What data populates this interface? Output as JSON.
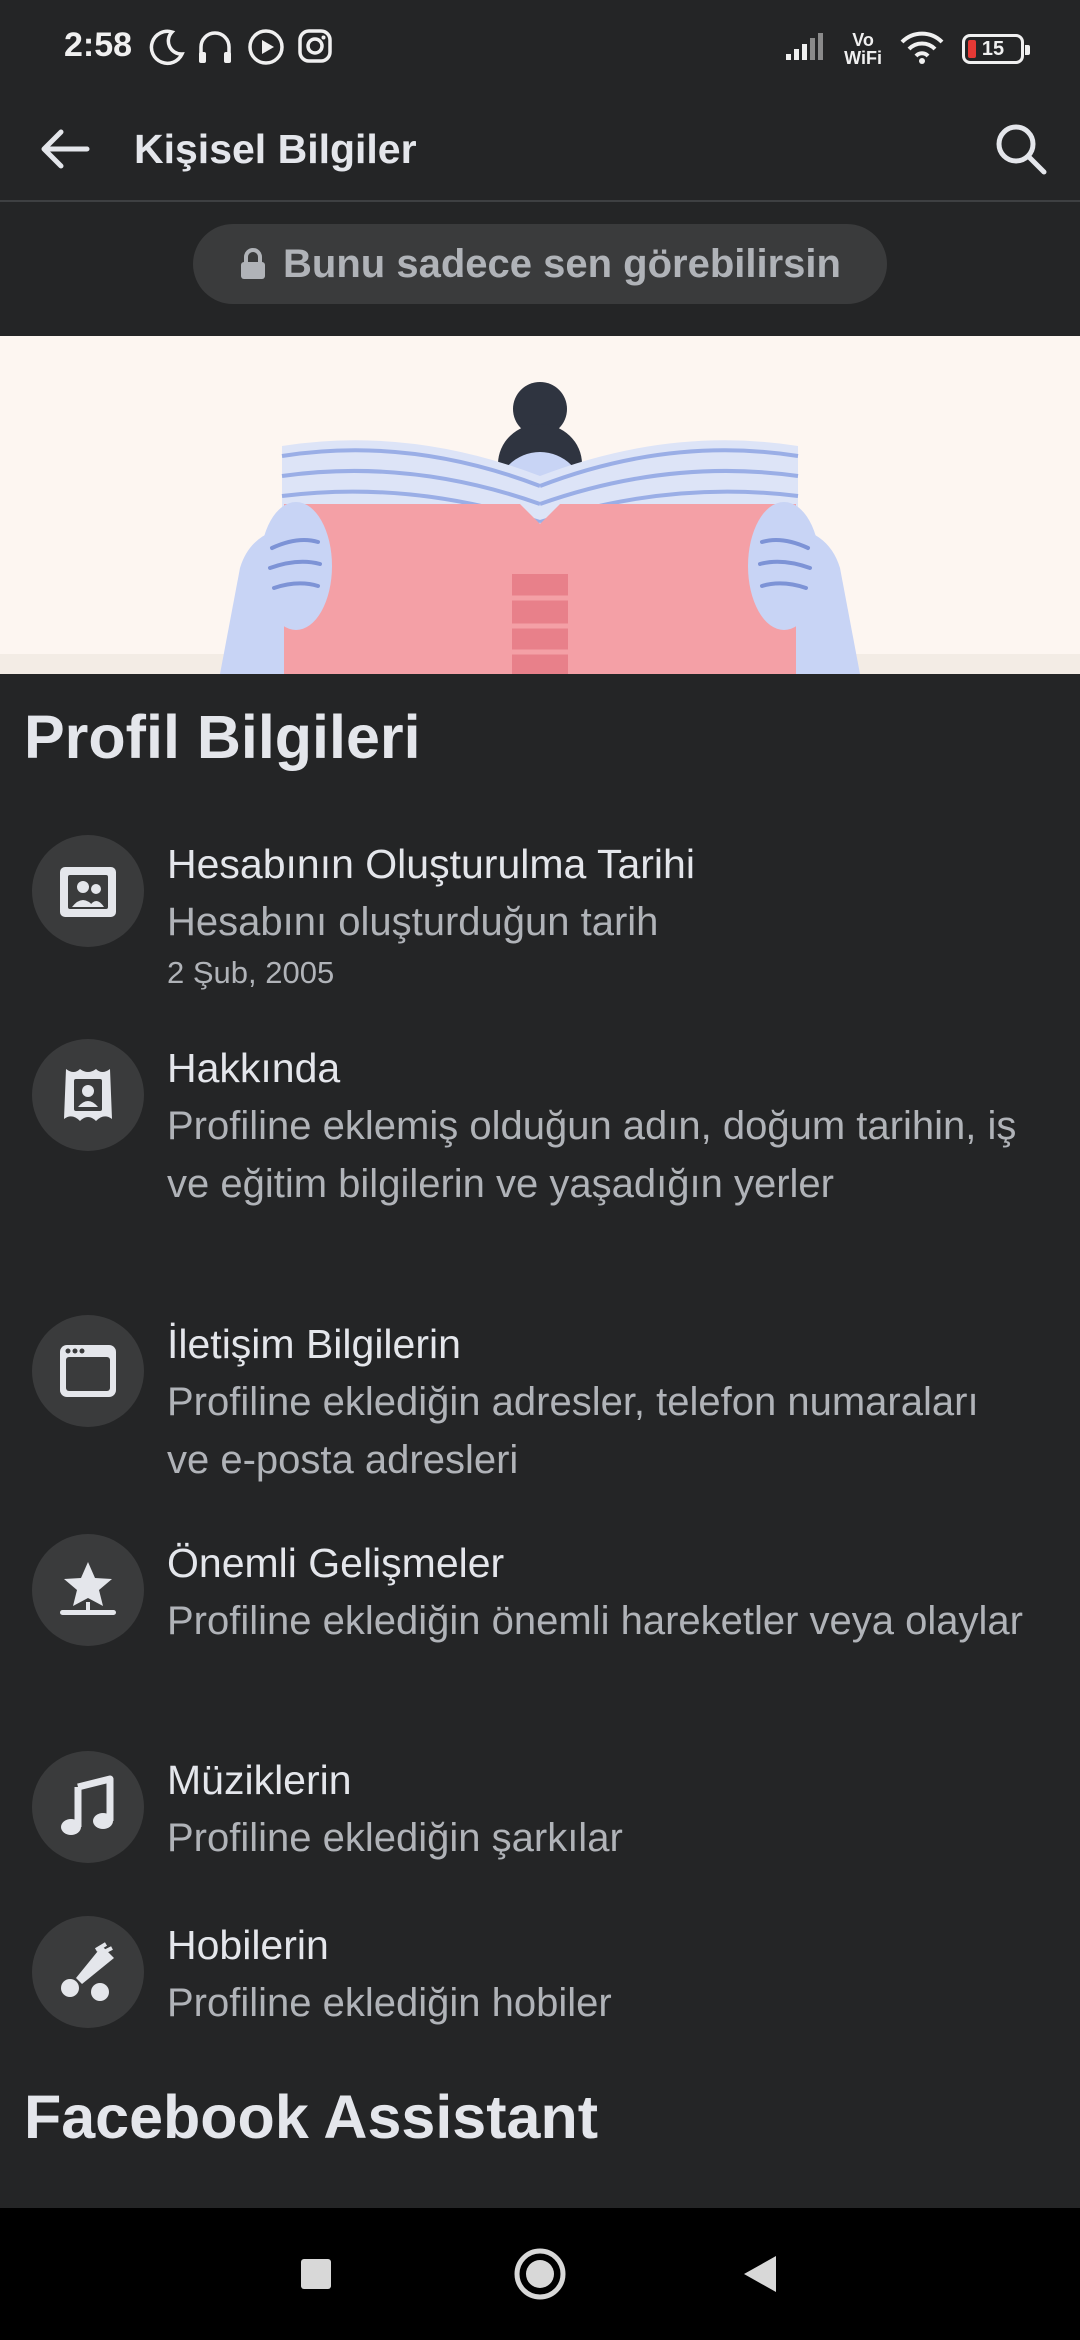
{
  "status_bar": {
    "time": "2:58",
    "volte_line1": "Vo",
    "volte_line2": "WiFi",
    "battery_level": "15",
    "battery_color": "#e53935"
  },
  "header": {
    "title": "Kişisel Bilgiler",
    "back_icon": "arrow-left-icon",
    "search_icon": "search-icon"
  },
  "privacy_notice": {
    "text": "Bunu sadece sen görebilirsin",
    "icon": "lock-icon"
  },
  "banner": {
    "illustration": "person-reading-book"
  },
  "profile_section": {
    "title": "Profil Bilgileri",
    "items": [
      {
        "icon": "profile-card-icon",
        "title": "Hesabının Oluşturulma Tarihi",
        "description": "Hesabını oluşturduğun tarih",
        "meta": "2 Şub, 2005"
      },
      {
        "icon": "portrait-frame-icon",
        "title": "Hakkında",
        "description": "Profiline eklemiş olduğun adın, doğum tarihin, iş ve eğitim bilgilerin ve yaşadığın yerler"
      },
      {
        "icon": "browser-window-icon",
        "title": "İletişim Bilgilerin",
        "description": "Profiline eklediğin adresler, telefon numaraları ve e-posta adresleri"
      },
      {
        "icon": "star-milestone-icon",
        "title": "Önemli Gelişmeler",
        "description": "Profiline eklediğin önemli hareketler veya olaylar"
      },
      {
        "icon": "music-note-icon",
        "title": "Müziklerin",
        "description": "Profiline eklediğin şarkılar"
      },
      {
        "icon": "hobby-brush-icon",
        "title": "Hobilerin",
        "description": "Profiline eklediğin hobiler"
      }
    ]
  },
  "assistant_section": {
    "title": "Facebook Assistant"
  },
  "nav_bar": {
    "recents_icon": "square-icon",
    "home_icon": "circle-home-icon",
    "back_icon": "triangle-back-icon"
  },
  "colors": {
    "background": "#242526",
    "surface": "#3a3b3c",
    "primary_text": "#e4e6eb",
    "secondary_text": "#b0b3b8"
  }
}
